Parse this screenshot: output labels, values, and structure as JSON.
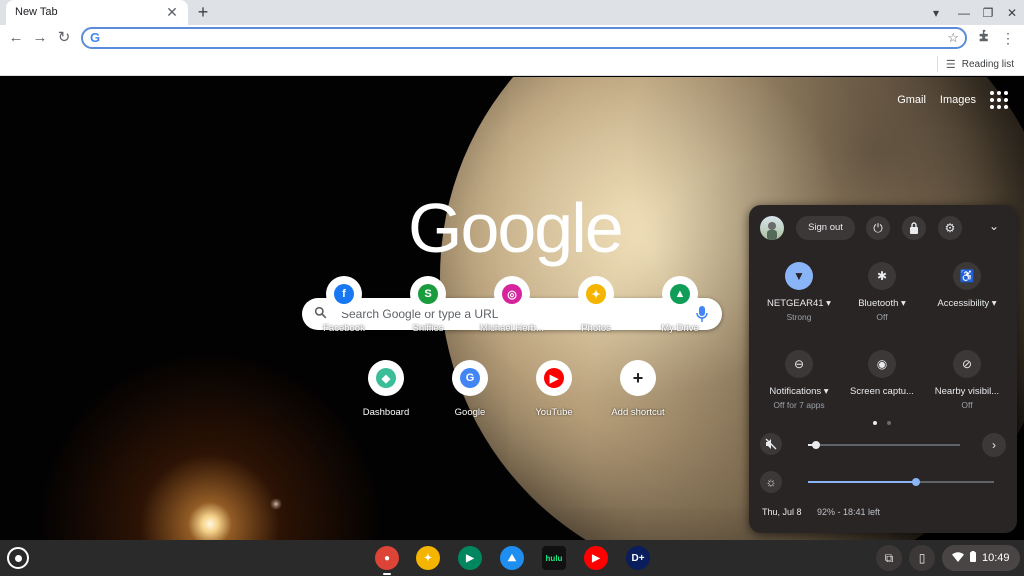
{
  "browser": {
    "tab_title": "New Tab",
    "tab_close": "✕",
    "new_tab": "+",
    "window_controls": [
      "▾",
      "—",
      "❐",
      "✕"
    ],
    "nav": {
      "back": "←",
      "forward": "→",
      "reload": "↻"
    },
    "omnibox": {
      "value": "",
      "g_icon": "G",
      "star_icon": "☆"
    },
    "extensions_icon": "puzzle-icon",
    "menu_icon": "⋮",
    "reading_list": "Reading list"
  },
  "ntp": {
    "top_links": [
      "Gmail",
      "Images"
    ],
    "logo": "Google",
    "search_placeholder": "Search Google or type a URL",
    "shortcuts": [
      {
        "label": "Facebook",
        "icon": "f",
        "color": "#1877f2"
      },
      {
        "label": "Sniffies",
        "icon": "S",
        "color": "#1a9c3e"
      },
      {
        "label": "Michael Herb...",
        "icon": "◎",
        "color": "#d6249f"
      },
      {
        "label": "Photos",
        "icon": "✦",
        "color": "#f4b400"
      },
      {
        "label": "My Drive",
        "icon": "▲",
        "color": "#0f9d58"
      },
      {
        "label": "Dashboard",
        "icon": "◆",
        "color": "#3bbd9a"
      },
      {
        "label": "Google",
        "icon": "G",
        "color": "#4285f4"
      },
      {
        "label": "YouTube",
        "icon": "▶",
        "color": "#ff0000"
      },
      {
        "label": "Add shortcut",
        "icon": "+",
        "color": "#202124"
      }
    ]
  },
  "quick_settings": {
    "sign_out": "Sign out",
    "power_icon": "⏻",
    "lock_icon": "🔒",
    "settings_icon": "⚙",
    "collapse_icon": "⌄",
    "tiles": [
      {
        "label": "NETGEAR41 ▾",
        "sub": "Strong",
        "icon": "▼",
        "on": true
      },
      {
        "label": "Bluetooth ▾",
        "sub": "Off",
        "icon": "✱",
        "on": false
      },
      {
        "label": "Accessibility ▾",
        "sub": "",
        "icon": "♿",
        "on": false
      },
      {
        "label": "Notifications ▾",
        "sub": "Off for 7 apps",
        "icon": "⊖",
        "on": false
      },
      {
        "label": "Screen captu...",
        "sub": "",
        "icon": "◉",
        "on": false
      },
      {
        "label": "Nearby visibil...",
        "sub": "Off",
        "icon": "⊘",
        "on": false
      }
    ],
    "volume_level": 0.05,
    "brightness_level": 0.58,
    "mute_icon": "🔇",
    "audio_settings_icon": "›",
    "brightness_icon": "☼",
    "date": "Thu, Jul 8",
    "battery": "92% - 18:41 left"
  },
  "shelf": {
    "apps": [
      {
        "name": "Chrome",
        "color": "#db4437",
        "icon": "●"
      },
      {
        "name": "Photos",
        "color": "#f4b400",
        "icon": "✦"
      },
      {
        "name": "Play Store",
        "color": "#01875f",
        "icon": "▶"
      },
      {
        "name": "Prime Video",
        "color": "#1f8ef1",
        "icon": "⛰"
      },
      {
        "name": "Hulu",
        "color": "#111111",
        "icon": "hulu"
      },
      {
        "name": "YouTube Music",
        "color": "#ff0000",
        "icon": "▶"
      },
      {
        "name": "Disney+",
        "color": "#0a1d5c",
        "icon": "D+"
      }
    ],
    "tray": {
      "holding_space": "⧉",
      "phone": "▯",
      "time": "10:49",
      "wifi": "▼",
      "battery": "▮"
    }
  }
}
